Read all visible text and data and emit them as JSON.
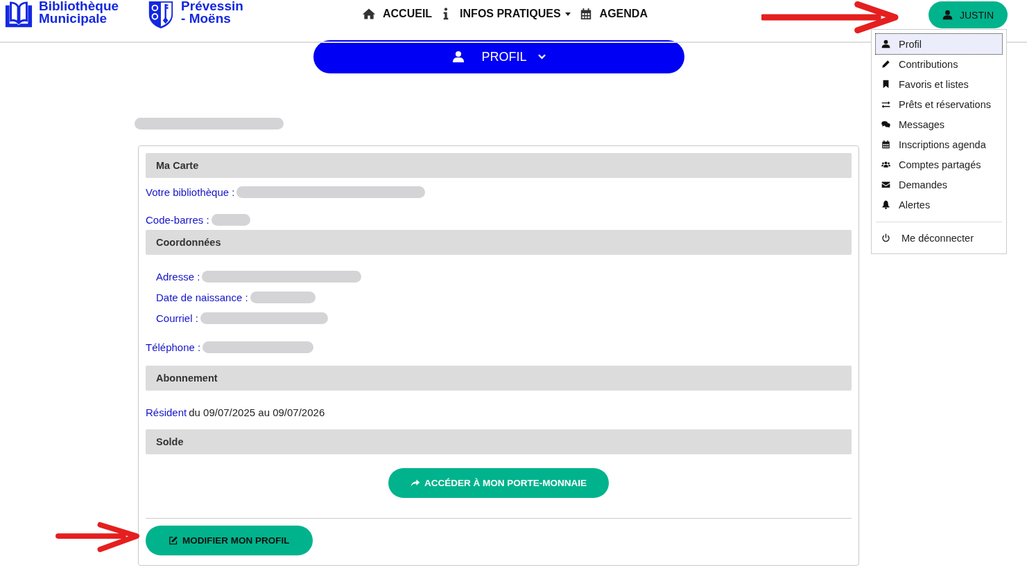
{
  "header": {
    "logos": [
      {
        "kind": "book",
        "lines": [
          "Bibliothèque",
          "Municipale"
        ]
      },
      {
        "kind": "crest",
        "lines": [
          "Prévessin",
          "- Moëns"
        ]
      }
    ],
    "nav": [
      {
        "label": "ACCUEIL",
        "caret": false
      },
      {
        "label": "INFOS PRATIQUES",
        "caret": true
      },
      {
        "label": "AGENDA",
        "caret": false
      }
    ],
    "user_button": {
      "label": "JUSTIN"
    }
  },
  "user_menu": {
    "items": [
      {
        "label": "Profil",
        "selected": true
      },
      {
        "label": "Contributions",
        "selected": false
      },
      {
        "label": "Favoris et listes",
        "selected": false
      },
      {
        "label": "Prêts et réservations",
        "selected": false
      },
      {
        "label": "Messages",
        "selected": false
      },
      {
        "label": "Inscriptions agenda",
        "selected": false
      },
      {
        "label": "Comptes partagés",
        "selected": false
      },
      {
        "label": "Demandes",
        "selected": false
      },
      {
        "label": "Alertes",
        "selected": false
      }
    ],
    "logout": {
      "label": "Me déconnecter"
    }
  },
  "profile_bar": {
    "label": "PROFIL"
  },
  "sections": [
    {
      "title": "Ma Carte",
      "rows": [
        {
          "kind": "field",
          "label": "Votre bibliothèque :"
        },
        {
          "kind": "field",
          "label": "Code-barres :"
        }
      ]
    },
    {
      "title": "Coordonnées",
      "rows": [
        {
          "kind": "indented",
          "label": "Adresse :"
        },
        {
          "kind": "indented",
          "label": "Date de naissance :"
        },
        {
          "kind": "indented",
          "label": "Courriel :"
        },
        {
          "kind": "field",
          "label": "Téléphone :"
        }
      ]
    },
    {
      "title": "Abonnement",
      "rows": [
        {
          "kind": "subscription",
          "label": "Résident",
          "text": "du 09/07/2025 au 09/07/2026"
        }
      ]
    },
    {
      "title": "Solde",
      "rows": [
        {
          "kind": "button",
          "label": "ACCÉDER À MON PORTE-MONNAIE"
        }
      ]
    }
  ],
  "edit_button": {
    "label": "MODIFIER MON PROFIL"
  }
}
